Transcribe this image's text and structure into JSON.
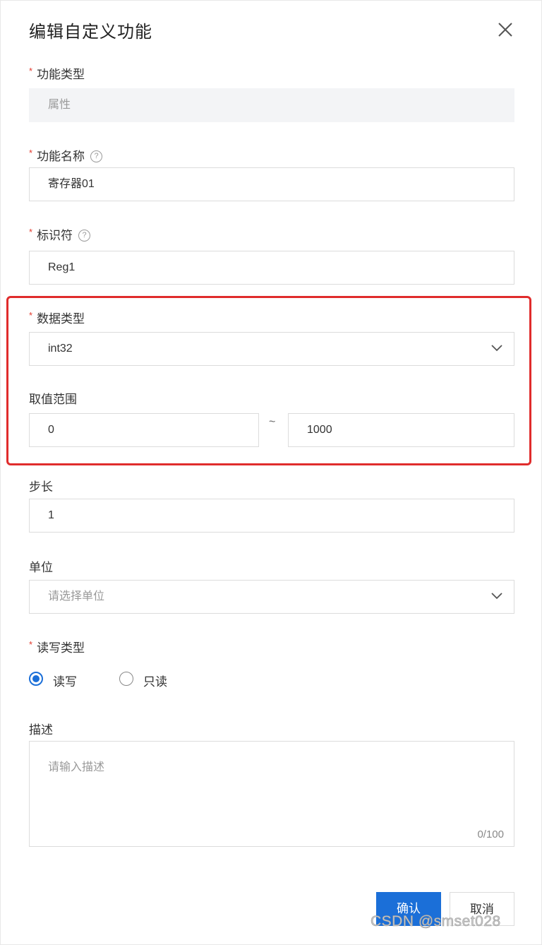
{
  "dialog": {
    "title": "编辑自定义功能",
    "close_icon": "close-icon"
  },
  "fields": {
    "function_type": {
      "label": "功能类型",
      "required": "*",
      "value": "属性"
    },
    "function_name": {
      "label": "功能名称",
      "required": "*",
      "help_icon": "help-circle-icon",
      "value": "寄存器01"
    },
    "identifier": {
      "label": "标识符",
      "required": "*",
      "help_icon": "help-circle-icon",
      "value": "Reg1"
    },
    "data_type": {
      "label": "数据类型",
      "required": "*",
      "value": "int32",
      "dropdown_icon": "chevron-down-icon"
    },
    "value_range": {
      "label": "取值范围",
      "min": "0",
      "separator": "~",
      "max": "1000"
    },
    "step": {
      "label": "步长",
      "value": "1"
    },
    "unit": {
      "label": "单位",
      "placeholder": "请选择单位",
      "dropdown_icon": "chevron-down-icon"
    },
    "rw_type": {
      "label": "读写类型",
      "required": "*",
      "options": [
        {
          "label": "读写",
          "selected": true
        },
        {
          "label": "只读",
          "selected": false
        }
      ]
    },
    "description": {
      "label": "描述",
      "placeholder": "请输入描述",
      "counter": "0/100"
    }
  },
  "footer": {
    "confirm_label": "确认",
    "cancel_label": "取消"
  },
  "watermark": "CSDN @smset028",
  "colors": {
    "primary": "#1b6fd8",
    "required": "#e23b2e",
    "highlight_frame": "#e02c2c"
  }
}
